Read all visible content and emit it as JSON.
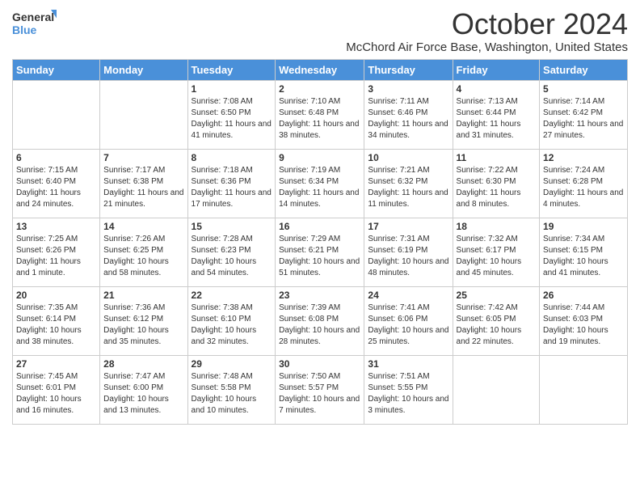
{
  "logo": {
    "general": "General",
    "blue": "Blue"
  },
  "header": {
    "month": "October 2024",
    "location": "McChord Air Force Base, Washington, United States"
  },
  "weekdays": [
    "Sunday",
    "Monday",
    "Tuesday",
    "Wednesday",
    "Thursday",
    "Friday",
    "Saturday"
  ],
  "weeks": [
    [
      {
        "day": "",
        "info": ""
      },
      {
        "day": "",
        "info": ""
      },
      {
        "day": "1",
        "info": "Sunrise: 7:08 AM\nSunset: 6:50 PM\nDaylight: 11 hours and 41 minutes."
      },
      {
        "day": "2",
        "info": "Sunrise: 7:10 AM\nSunset: 6:48 PM\nDaylight: 11 hours and 38 minutes."
      },
      {
        "day": "3",
        "info": "Sunrise: 7:11 AM\nSunset: 6:46 PM\nDaylight: 11 hours and 34 minutes."
      },
      {
        "day": "4",
        "info": "Sunrise: 7:13 AM\nSunset: 6:44 PM\nDaylight: 11 hours and 31 minutes."
      },
      {
        "day": "5",
        "info": "Sunrise: 7:14 AM\nSunset: 6:42 PM\nDaylight: 11 hours and 27 minutes."
      }
    ],
    [
      {
        "day": "6",
        "info": "Sunrise: 7:15 AM\nSunset: 6:40 PM\nDaylight: 11 hours and 24 minutes."
      },
      {
        "day": "7",
        "info": "Sunrise: 7:17 AM\nSunset: 6:38 PM\nDaylight: 11 hours and 21 minutes."
      },
      {
        "day": "8",
        "info": "Sunrise: 7:18 AM\nSunset: 6:36 PM\nDaylight: 11 hours and 17 minutes."
      },
      {
        "day": "9",
        "info": "Sunrise: 7:19 AM\nSunset: 6:34 PM\nDaylight: 11 hours and 14 minutes."
      },
      {
        "day": "10",
        "info": "Sunrise: 7:21 AM\nSunset: 6:32 PM\nDaylight: 11 hours and 11 minutes."
      },
      {
        "day": "11",
        "info": "Sunrise: 7:22 AM\nSunset: 6:30 PM\nDaylight: 11 hours and 8 minutes."
      },
      {
        "day": "12",
        "info": "Sunrise: 7:24 AM\nSunset: 6:28 PM\nDaylight: 11 hours and 4 minutes."
      }
    ],
    [
      {
        "day": "13",
        "info": "Sunrise: 7:25 AM\nSunset: 6:26 PM\nDaylight: 11 hours and 1 minute."
      },
      {
        "day": "14",
        "info": "Sunrise: 7:26 AM\nSunset: 6:25 PM\nDaylight: 10 hours and 58 minutes."
      },
      {
        "day": "15",
        "info": "Sunrise: 7:28 AM\nSunset: 6:23 PM\nDaylight: 10 hours and 54 minutes."
      },
      {
        "day": "16",
        "info": "Sunrise: 7:29 AM\nSunset: 6:21 PM\nDaylight: 10 hours and 51 minutes."
      },
      {
        "day": "17",
        "info": "Sunrise: 7:31 AM\nSunset: 6:19 PM\nDaylight: 10 hours and 48 minutes."
      },
      {
        "day": "18",
        "info": "Sunrise: 7:32 AM\nSunset: 6:17 PM\nDaylight: 10 hours and 45 minutes."
      },
      {
        "day": "19",
        "info": "Sunrise: 7:34 AM\nSunset: 6:15 PM\nDaylight: 10 hours and 41 minutes."
      }
    ],
    [
      {
        "day": "20",
        "info": "Sunrise: 7:35 AM\nSunset: 6:14 PM\nDaylight: 10 hours and 38 minutes."
      },
      {
        "day": "21",
        "info": "Sunrise: 7:36 AM\nSunset: 6:12 PM\nDaylight: 10 hours and 35 minutes."
      },
      {
        "day": "22",
        "info": "Sunrise: 7:38 AM\nSunset: 6:10 PM\nDaylight: 10 hours and 32 minutes."
      },
      {
        "day": "23",
        "info": "Sunrise: 7:39 AM\nSunset: 6:08 PM\nDaylight: 10 hours and 28 minutes."
      },
      {
        "day": "24",
        "info": "Sunrise: 7:41 AM\nSunset: 6:06 PM\nDaylight: 10 hours and 25 minutes."
      },
      {
        "day": "25",
        "info": "Sunrise: 7:42 AM\nSunset: 6:05 PM\nDaylight: 10 hours and 22 minutes."
      },
      {
        "day": "26",
        "info": "Sunrise: 7:44 AM\nSunset: 6:03 PM\nDaylight: 10 hours and 19 minutes."
      }
    ],
    [
      {
        "day": "27",
        "info": "Sunrise: 7:45 AM\nSunset: 6:01 PM\nDaylight: 10 hours and 16 minutes."
      },
      {
        "day": "28",
        "info": "Sunrise: 7:47 AM\nSunset: 6:00 PM\nDaylight: 10 hours and 13 minutes."
      },
      {
        "day": "29",
        "info": "Sunrise: 7:48 AM\nSunset: 5:58 PM\nDaylight: 10 hours and 10 minutes."
      },
      {
        "day": "30",
        "info": "Sunrise: 7:50 AM\nSunset: 5:57 PM\nDaylight: 10 hours and 7 minutes."
      },
      {
        "day": "31",
        "info": "Sunrise: 7:51 AM\nSunset: 5:55 PM\nDaylight: 10 hours and 3 minutes."
      },
      {
        "day": "",
        "info": ""
      },
      {
        "day": "",
        "info": ""
      }
    ]
  ]
}
